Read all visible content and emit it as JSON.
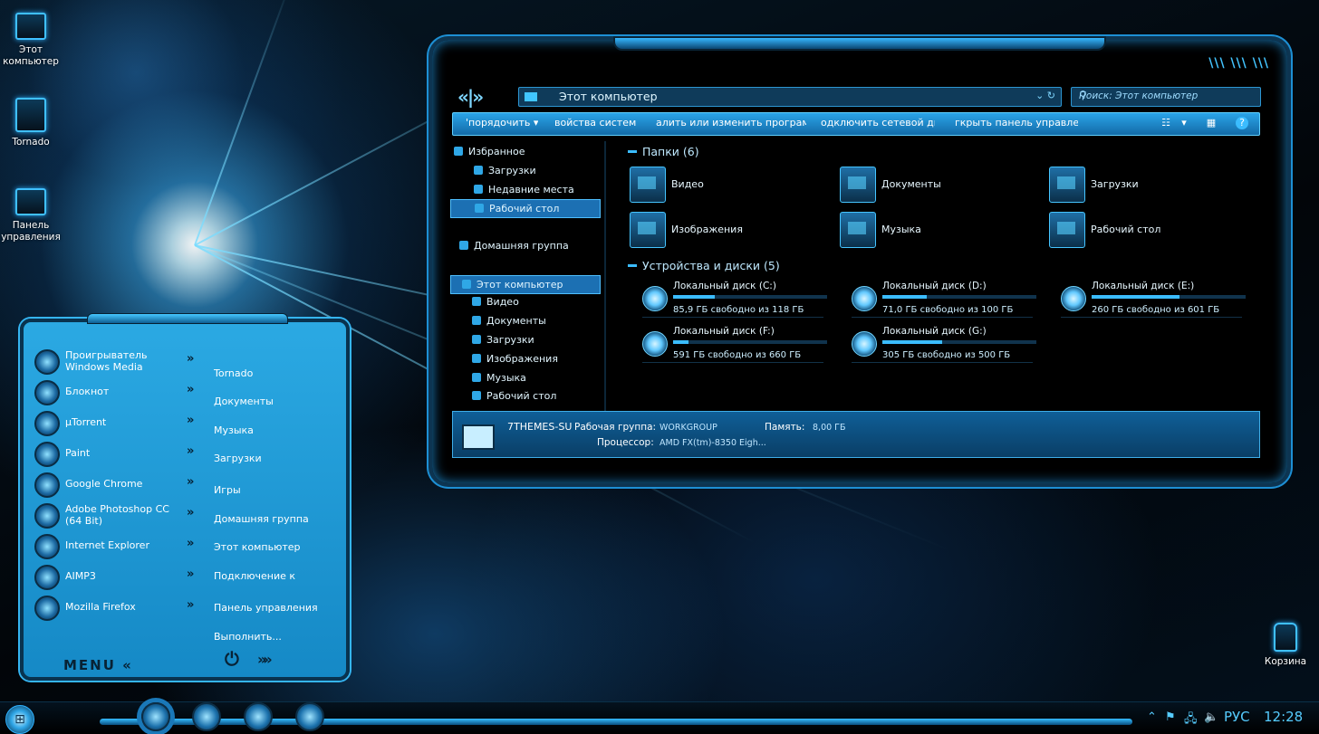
{
  "desktop": {
    "icons": [
      {
        "label": "Этот компьютер",
        "icon": "computer-icon"
      },
      {
        "label": "Tornado",
        "icon": "user-icon"
      },
      {
        "label": "Панель управления",
        "icon": "control-panel-icon"
      },
      {
        "label": "Корзина",
        "icon": "recycle-bin-icon"
      }
    ]
  },
  "explorer": {
    "nav_buttons": "«|»",
    "address_path": "Этот компьютер",
    "search_placeholder": "Поиск: Этот компьютер",
    "commands": [
      "'порядочить ▾",
      "войства систем",
      "алить или изменить програм",
      "одключить сетевой ди",
      "гкрыть панель управлени"
    ],
    "nav_pane": {
      "favorites": "Избранное",
      "favorites_items": [
        "Загрузки",
        "Недавние места",
        "Рабочий стол"
      ],
      "homegroup": "Домашняя группа",
      "this_pc": "Этот компьютер",
      "this_pc_items": [
        "Видео",
        "Документы",
        "Загрузки",
        "Изображения",
        "Музыка",
        "Рабочий стол"
      ]
    },
    "folders_header": "Папки (6)",
    "folders": [
      "Видео",
      "Документы",
      "Загрузки",
      "Изображения",
      "Музыка",
      "Рабочий стол"
    ],
    "devices_header": "Устройства и диски (5)",
    "drives": [
      {
        "name": "Локальный диск (C:)",
        "free": "85,9 ГБ свободно из 118 ГБ",
        "used_fraction": 0.27
      },
      {
        "name": "Локальный диск (D:)",
        "free": "71,0 ГБ свободно из 100 ГБ",
        "used_fraction": 0.29
      },
      {
        "name": "Локальный диск (E:)",
        "free": "260 ГБ свободно из 601 ГБ",
        "used_fraction": 0.57
      },
      {
        "name": "Локальный диск (F:)",
        "free": "591 ГБ свободно из 660 ГБ",
        "used_fraction": 0.1
      },
      {
        "name": "Локальный диск (G:)",
        "free": "305 ГБ свободно из 500 ГБ",
        "used_fraction": 0.39
      }
    ],
    "details": {
      "pc_name": "7THEMES-SU",
      "workgroup_label": "Рабочая группа:",
      "workgroup_value": "WORKGROUP",
      "memory_label": "Память:",
      "memory_value": "8,00 ГБ",
      "cpu_label": "Процессор:",
      "cpu_value": "AMD FX(tm)-8350 Eigh..."
    }
  },
  "start_menu": {
    "apps": [
      "Проигрыватель Windows Media",
      "Блокнот",
      "µTorrent",
      "Paint",
      "Google Chrome",
      "Adobe Photoshop CC (64 Bit)",
      "Internet Explorer",
      "AIMP3",
      "Mozilla Firefox"
    ],
    "places": [
      "Tornado",
      "Документы",
      "Музыка",
      "Загрузки",
      "Игры",
      "Домашняя группа",
      "Этот компьютер",
      "Подключение к",
      "Панель управления",
      "Выполнить..."
    ],
    "menu_label": "MENU",
    "menu_arrow": "«",
    "power_arrows": "»»"
  },
  "taskbar": {
    "language": "РУС",
    "time": "12:28"
  }
}
